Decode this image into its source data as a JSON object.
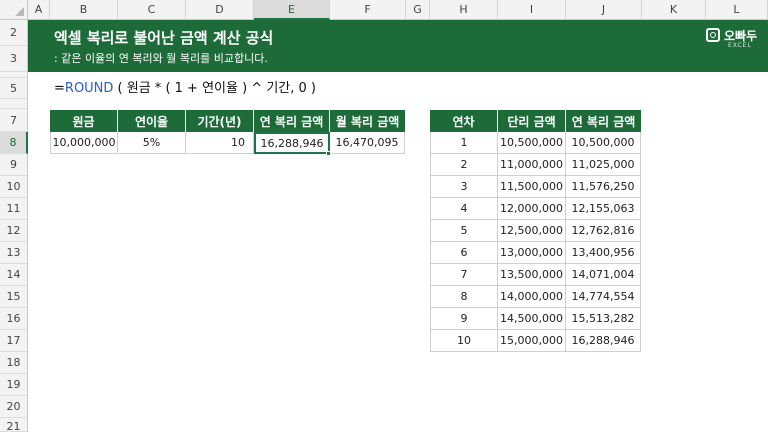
{
  "columns": [
    "A",
    "B",
    "C",
    "D",
    "E",
    "F",
    "G",
    "H",
    "I",
    "J",
    "K",
    "L"
  ],
  "rows": [
    "2",
    "3",
    "4",
    "5",
    "6",
    "7",
    "8",
    "9",
    "10",
    "11",
    "12",
    "13",
    "14",
    "15",
    "16",
    "17",
    "18",
    "19",
    "20",
    "21"
  ],
  "selected_column": "E",
  "selected_row": "8",
  "banner": {
    "title": "엑셀 복리로 불어난 금액 계산 공식",
    "subtitle": ": 같은 이율의 연 복리와 월 복리를 비교합니다.",
    "logo_name": "오빠두",
    "logo_sub": "EXCEL"
  },
  "formula": {
    "prefix": "=",
    "function": "ROUND",
    "rest": " ( 원금 * ( 1 + 연이율 ) ^ 기간, 0 )"
  },
  "left_table": {
    "headers": [
      "원금",
      "연이율",
      "기간(년)",
      "연 복리 금액",
      "월 복리 금액"
    ],
    "row": [
      "10,000,000",
      "5%",
      "10",
      "16,288,946",
      "16,470,095"
    ]
  },
  "right_table": {
    "headers": [
      "연차",
      "단리 금액",
      "연 복리 금액"
    ],
    "rows": [
      [
        "1",
        "10,500,000",
        "10,500,000"
      ],
      [
        "2",
        "11,000,000",
        "11,025,000"
      ],
      [
        "3",
        "11,500,000",
        "11,576,250"
      ],
      [
        "4",
        "12,000,000",
        "12,155,063"
      ],
      [
        "5",
        "12,500,000",
        "12,762,816"
      ],
      [
        "6",
        "13,000,000",
        "13,400,956"
      ],
      [
        "7",
        "13,500,000",
        "14,071,004"
      ],
      [
        "8",
        "14,000,000",
        "14,774,554"
      ],
      [
        "9",
        "14,500,000",
        "15,513,282"
      ],
      [
        "10",
        "15,000,000",
        "16,288,946"
      ]
    ]
  },
  "colors": {
    "accent": "#1e6b3a",
    "function": "#2a5bd7"
  }
}
